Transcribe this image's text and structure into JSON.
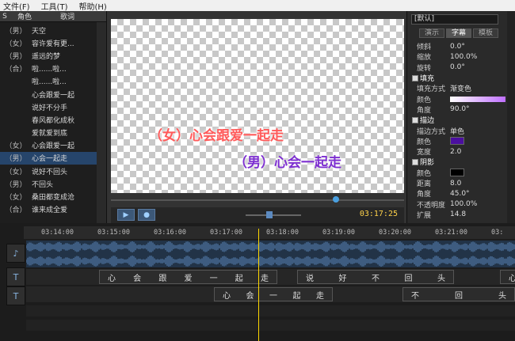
{
  "menu": [
    "文件(F)",
    "工具(T)",
    "帮助(H)"
  ],
  "list": {
    "headers": {
      "s": "S",
      "role": "角色",
      "lyrics": "歌词"
    },
    "rows": [
      {
        "role": "（男）",
        "text": "天空"
      },
      {
        "role": "（女）",
        "text": "容许爱有更..."
      },
      {
        "role": "（男）",
        "text": "遥远的梦"
      },
      {
        "role": "（合）",
        "text": "啦......啦..."
      },
      {
        "role": "",
        "text": "啦......啦..."
      },
      {
        "role": "",
        "text": "心会跟爱一起"
      },
      {
        "role": "",
        "text": "说好不分手"
      },
      {
        "role": "",
        "text": "春风都化成秋"
      },
      {
        "role": "",
        "text": "爱就爱到底"
      },
      {
        "role": "（女）",
        "text": "心会跟爱一起"
      },
      {
        "role": "（男）",
        "text": "心会一起走"
      },
      {
        "role": "（女）",
        "text": "说好不回头"
      },
      {
        "role": "（男）",
        "text": "不回头"
      },
      {
        "role": "（女）",
        "text": "桑田都变成沧"
      },
      {
        "role": "（合）",
        "text": "谁来成全爱"
      }
    ],
    "selected_index": 10
  },
  "preview": {
    "subtitle_female": "（女）心会跟爱一起走",
    "subtitle_male": "（男）心会一起走",
    "timecode": "03:17:25",
    "play_icon": "▶",
    "stop_icon": "●"
  },
  "props": {
    "preset": "[默认]",
    "tabs": [
      "演示",
      "字幕",
      "模板"
    ],
    "active_tab": 1,
    "rows": [
      {
        "label": "倾斜",
        "value": "0.0°"
      },
      {
        "label": "缩放",
        "value": "100.0%"
      },
      {
        "label": "旋转",
        "value": "0.0°"
      },
      {
        "label": "填充",
        "value": "",
        "section": true
      },
      {
        "label": "填充方式",
        "value": "渐变色"
      },
      {
        "label": "颜色",
        "value": ""
      },
      {
        "label": "角度",
        "value": "90.0°"
      },
      {
        "label": "描边",
        "value": "",
        "section": true
      },
      {
        "label": "描边方式",
        "value": "单色"
      },
      {
        "label": "颜色",
        "value": ""
      },
      {
        "label": "宽度",
        "value": "2.0"
      },
      {
        "label": "阴影",
        "value": "",
        "section": true
      },
      {
        "label": "颜色",
        "value": ""
      },
      {
        "label": "距离",
        "value": "8.0"
      },
      {
        "label": "角度",
        "value": "45.0°"
      },
      {
        "label": "不透明度",
        "value": "100.0%"
      },
      {
        "label": "扩展",
        "value": "14.8"
      }
    ],
    "fill_gradient": [
      "#ffffff",
      "#c070ff"
    ],
    "stroke_color": "#4b0fa0",
    "shadow_color": "#000000"
  },
  "timeline": {
    "ticks": [
      "03:14:00",
      "03:15:00",
      "03:16:00",
      "03:17:00",
      "03:18:00",
      "03:19:00",
      "03:20:00",
      "03:21:00",
      "03:"
    ],
    "track1_clips": [
      {
        "text": [
          "心",
          "会",
          "跟",
          "爱",
          "一",
          "起",
          "走"
        ]
      },
      {
        "text": [
          "说",
          "好",
          "不",
          "回",
          "头"
        ]
      },
      {
        "text": [
          "心"
        ]
      }
    ],
    "track2_clips": [
      {
        "text": [
          "心",
          "会",
          "一",
          "起",
          "走"
        ]
      },
      {
        "text": [
          "不",
          "回",
          "头"
        ]
      }
    ],
    "music_icon": "♪",
    "text_icon": "T"
  }
}
